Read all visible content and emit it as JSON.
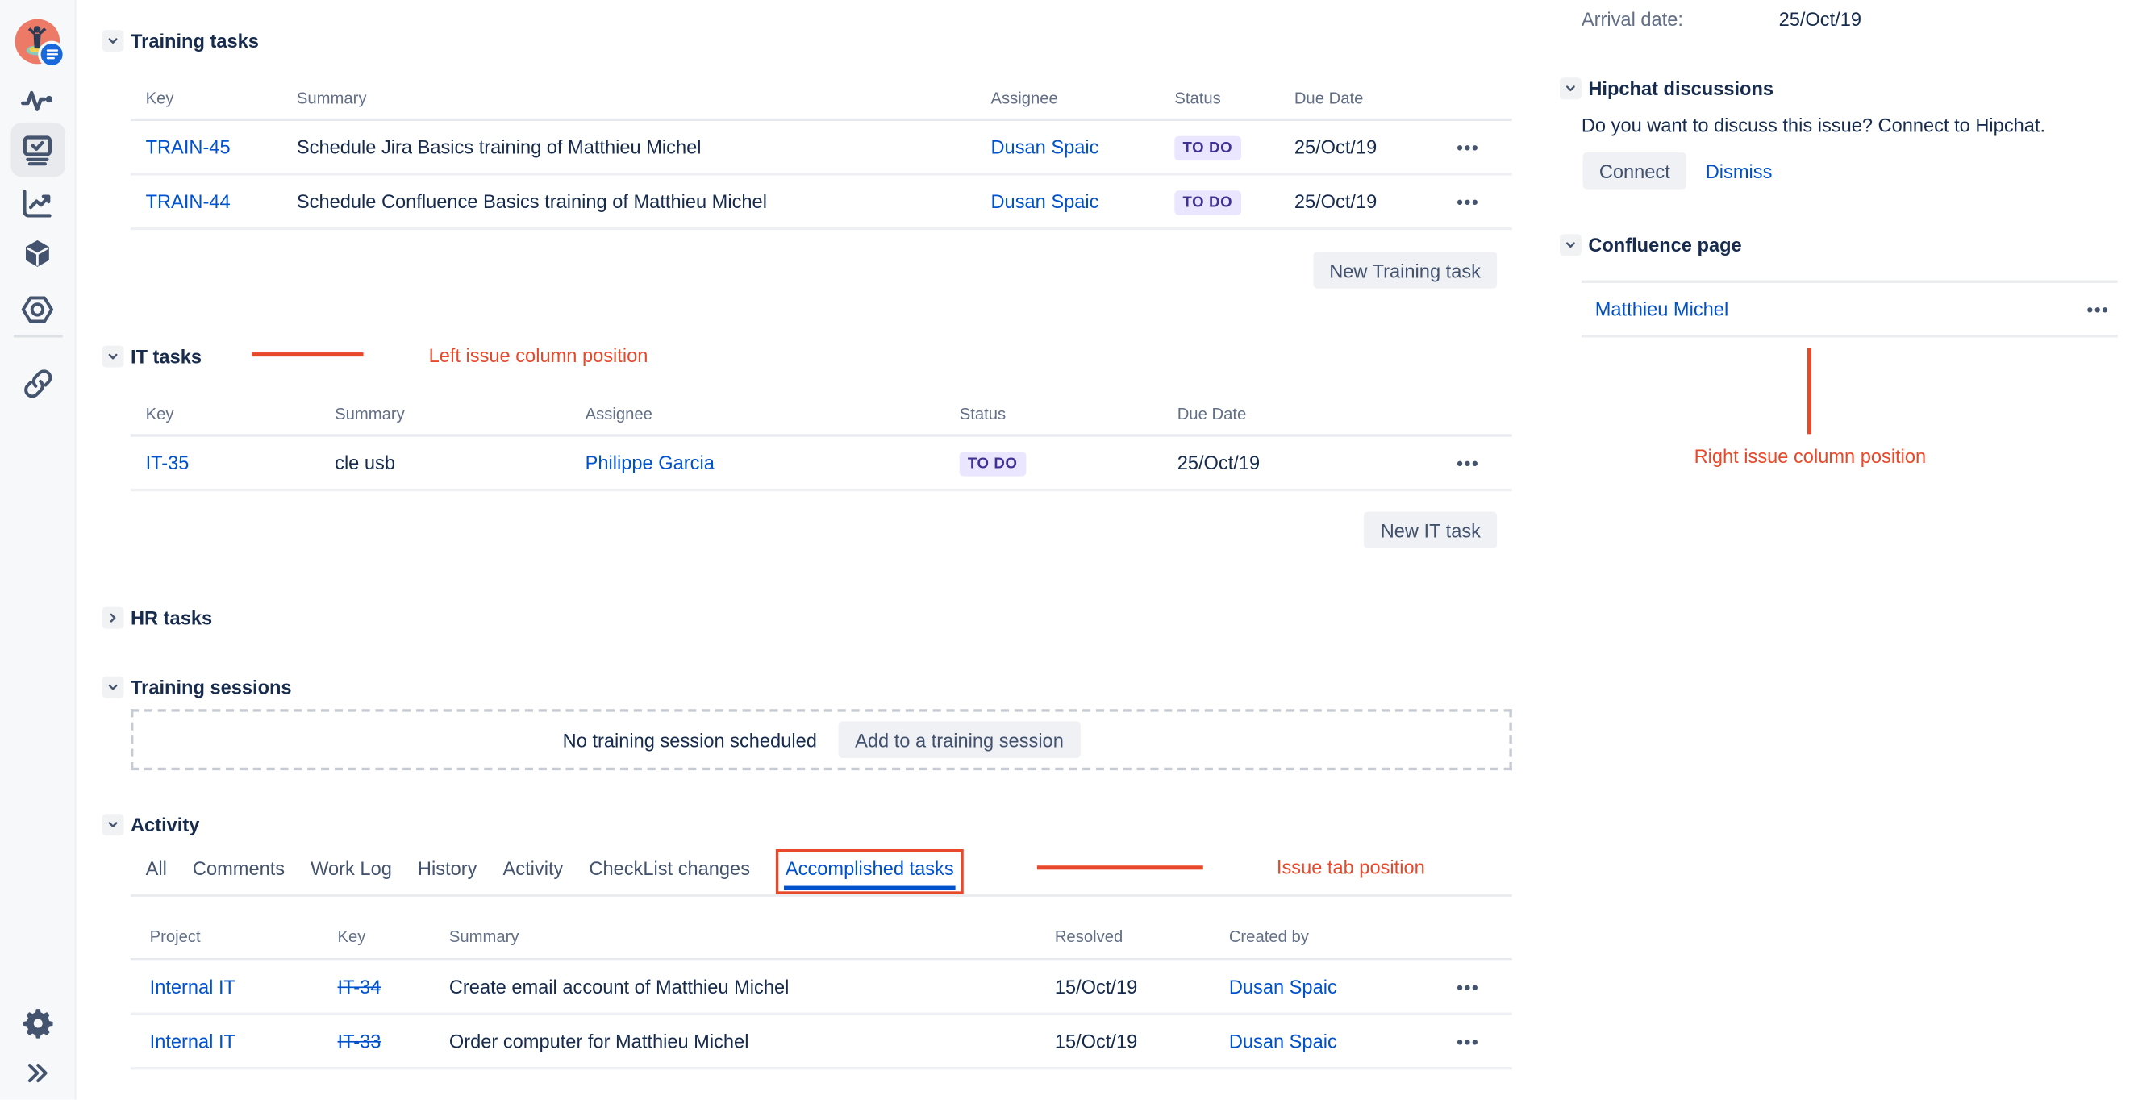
{
  "ui": {
    "ellipsis": "•••"
  },
  "sidebar": {
    "icons": [
      "user-avatar",
      "activity-pulse",
      "screens-tasks",
      "chart-trend",
      "apps-cube",
      "hex-nut",
      "link",
      "settings-gear",
      "expand-double-chevron"
    ]
  },
  "sections": {
    "training": {
      "title": "Training tasks",
      "columns": {
        "key": "Key",
        "summary": "Summary",
        "assignee": "Assignee",
        "status": "Status",
        "due": "Due Date"
      },
      "rows": [
        {
          "key": "TRAIN-45",
          "summary": "Schedule Jira Basics training of Matthieu Michel",
          "assignee": "Dusan Spaic",
          "status": "TO DO",
          "due": "25/Oct/19"
        },
        {
          "key": "TRAIN-44",
          "summary": "Schedule Confluence Basics training of Matthieu Michel",
          "assignee": "Dusan Spaic",
          "status": "TO DO",
          "due": "25/Oct/19"
        }
      ],
      "button": "New Training task"
    },
    "it": {
      "title": "IT tasks",
      "columns": {
        "key": "Key",
        "summary": "Summary",
        "assignee": "Assignee",
        "status": "Status",
        "due": "Due Date"
      },
      "rows": [
        {
          "key": "IT-35",
          "summary": "cle usb",
          "assignee": "Philippe Garcia",
          "status": "TO DO",
          "due": "25/Oct/19"
        }
      ],
      "button": "New IT task"
    },
    "hr": {
      "title": "HR tasks"
    },
    "sessions": {
      "title": "Training sessions",
      "empty": "No training session scheduled",
      "button": "Add to a training session"
    },
    "activity": {
      "title": "Activity",
      "tabs": [
        "All",
        "Comments",
        "Work Log",
        "History",
        "Activity",
        "CheckList changes",
        "Accomplished tasks"
      ],
      "active_tab": "Accomplished tasks",
      "columns": {
        "project": "Project",
        "key": "Key",
        "summary": "Summary",
        "resolved": "Resolved",
        "created": "Created by"
      },
      "rows": [
        {
          "project": "Internal IT",
          "key": "IT-34",
          "summary": "Create email account of Matthieu Michel",
          "resolved": "15/Oct/19",
          "created": "Dusan Spaic"
        },
        {
          "project": "Internal IT",
          "key": "IT-33",
          "summary": "Order computer for Matthieu Michel",
          "resolved": "15/Oct/19",
          "created": "Dusan Spaic"
        }
      ]
    }
  },
  "right": {
    "arrival_label": "Arrival date:",
    "arrival_value": "25/Oct/19",
    "hipchat_title": "Hipchat discussions",
    "hipchat_text": "Do you want to discuss this issue? Connect to Hipchat.",
    "connect": "Connect",
    "dismiss": "Dismiss",
    "confluence_title": "Confluence page",
    "confluence_link": "Matthieu Michel"
  },
  "annotations": {
    "left": "Left issue column position",
    "tab": "Issue tab position",
    "right": "Right issue column position",
    "color": "#E8492B"
  },
  "colors": {
    "link": "#0052CC",
    "text": "#172B4D",
    "muted": "#626F86",
    "badge_bg": "#EAE6FF",
    "badge_text": "#403294"
  }
}
